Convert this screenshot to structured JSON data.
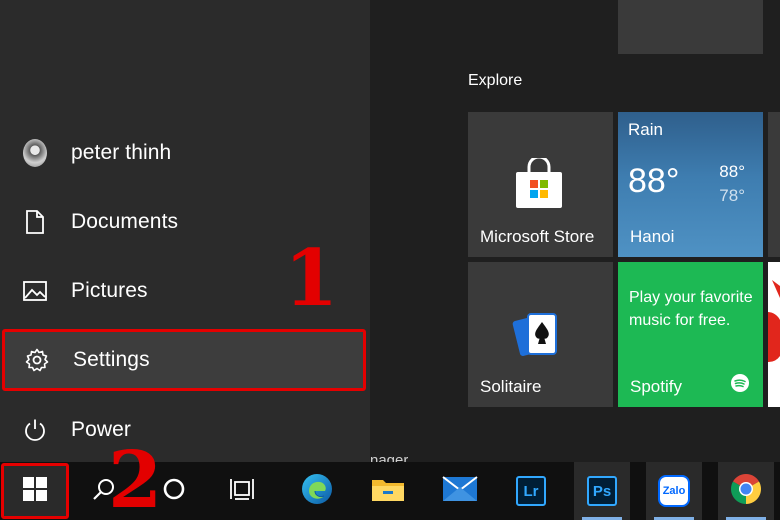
{
  "start_menu": {
    "items": [
      {
        "label": "peter thinh",
        "icon": "avatar"
      },
      {
        "label": "Documents",
        "icon": "document-icon"
      },
      {
        "label": "Pictures",
        "icon": "pictures-icon"
      },
      {
        "label": "Settings",
        "icon": "gear-icon"
      },
      {
        "label": "Power",
        "icon": "power-icon"
      }
    ]
  },
  "annotations": {
    "step1": "1",
    "step2": "2",
    "color": "#e30000"
  },
  "tiles": {
    "group_title": "Explore",
    "store": {
      "label": "Microsoft Store"
    },
    "weather": {
      "condition": "Rain",
      "temp": "88°",
      "high": "88°",
      "low": "78°",
      "city": "Hanoi"
    },
    "solitaire": {
      "label": "Solitaire"
    },
    "spotify": {
      "message": "Play your favorite music for free.",
      "label": "Spotify",
      "color": "#1db954"
    }
  },
  "taskbar": {
    "background_app_fragment": "nager",
    "items": [
      "windows-start-icon",
      "search-icon",
      "cortana-icon",
      "task-view-icon",
      "edge-icon",
      "file-explorer-icon",
      "mail-icon",
      "lightroom-icon",
      "photoshop-icon",
      "zalo-icon",
      "chrome-icon"
    ],
    "lightroom_text": "Lr",
    "photoshop_text": "Ps",
    "zalo_text": "Zalo"
  }
}
